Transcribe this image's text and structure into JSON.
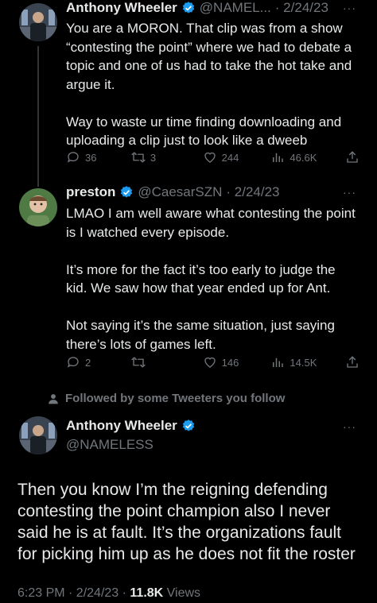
{
  "tweet1": {
    "name": "Anthony Wheeler",
    "handle": "@NAMEL...",
    "date": "· 2/24/23",
    "more": "···",
    "text": "You are a MORON. That clip was from a show “contesting the point” where we had to debate a topic and one of us had to take the hot take and argue it.\n\nWay to waste ur time finding downloading and uploading a clip just to look like a dweeb",
    "replies": "36",
    "retweets": "3",
    "likes": "244",
    "views": "46.6K"
  },
  "tweet2": {
    "name": "preston",
    "handle": "@CaesarSZN",
    "date": "· 2/24/23",
    "more": "···",
    "text": "LMAO I am well aware what contesting the point is I watched every episode.\n\nIt’s more for the fact it’s too early to judge the kid. We saw how that year ended up for Ant.\n\nNot saying it’s the same situation, just saying there’s lots of games left.",
    "replies": "2",
    "retweets": "",
    "likes": "146",
    "views": "14.5K"
  },
  "followed_note": "Followed by some Tweeters you follow",
  "main_tweet": {
    "name": "Anthony Wheeler",
    "handle": "@NAMELESS",
    "more": "···",
    "text": "Then you know I’m the reigning defending contesting the point champion also I never said he is at fault. It’s the organizations fault for picking him up as he does not fit the roster",
    "time_date": "6:23 PM · 2/24/23 · ",
    "views_count": "11.8K",
    "views_label": " Views"
  },
  "colors": {
    "verified": "#1d9bf0",
    "muted": "#71767b",
    "text": "#e7e9ea"
  }
}
